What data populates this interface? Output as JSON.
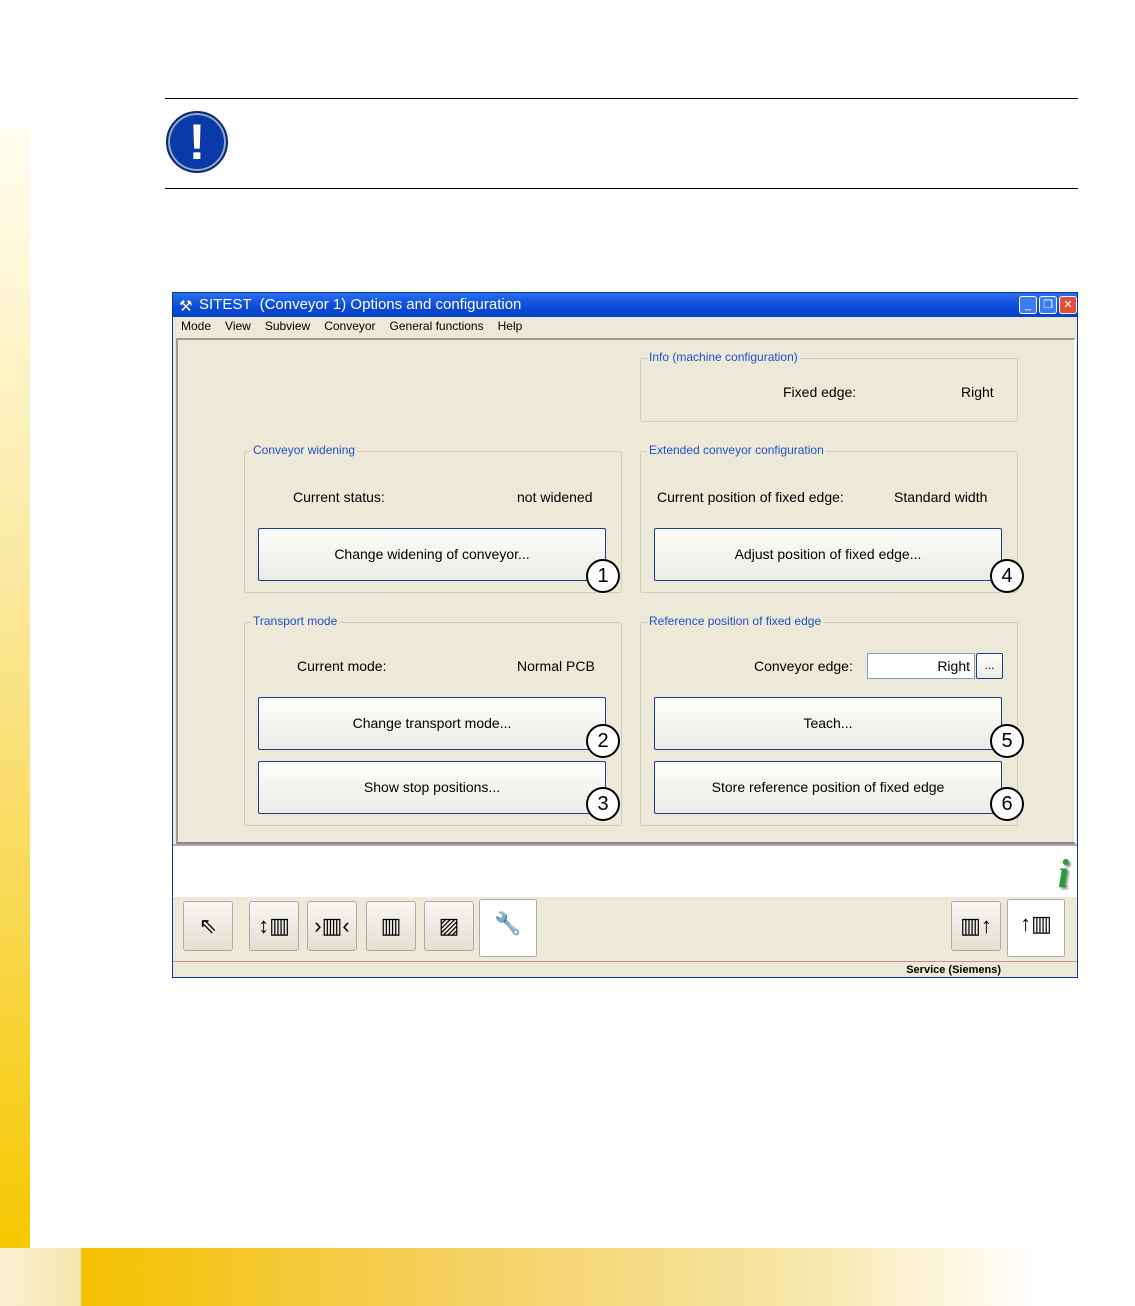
{
  "window": {
    "title": "SITEST  (Conveyor 1) Options and configuration"
  },
  "menu": [
    "Mode",
    "View",
    "Subview",
    "Conveyor",
    "General functions",
    "Help"
  ],
  "info": {
    "legend": "Info (machine configuration)",
    "label": "Fixed edge:",
    "value": "Right"
  },
  "widening": {
    "legend": "Conveyor widening",
    "label": "Current status:",
    "value": "not widened",
    "button": "Change widening of conveyor...",
    "marker": "1"
  },
  "extended": {
    "legend": "Extended conveyor configuration",
    "label": "Current position of fixed edge:",
    "value": "Standard width",
    "button": "Adjust position of fixed edge...",
    "marker": "4"
  },
  "transport": {
    "legend": "Transport mode",
    "label": "Current mode:",
    "value": "Normal PCB",
    "button1": "Change transport mode...",
    "marker1": "2",
    "button2": "Show stop positions...",
    "marker2": "3"
  },
  "reference": {
    "legend": "Reference position of fixed edge",
    "label": "Conveyor edge:",
    "value": "Right",
    "browse": "...",
    "button1": "Teach...",
    "marker1": "5",
    "button2": "Store reference position of fixed edge",
    "marker2": "6"
  },
  "status": {
    "user": "Service (Siemens)"
  },
  "note": {
    "symbol": "!"
  },
  "info_icon": "i"
}
